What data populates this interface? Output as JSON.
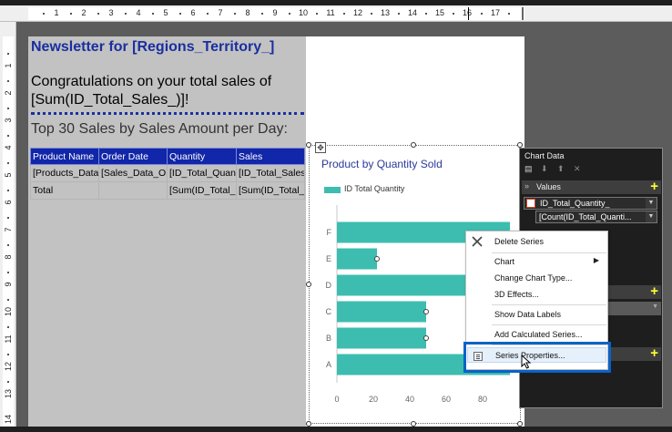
{
  "ruler": {
    "h_numbers": [
      "1",
      "2",
      "3",
      "4",
      "5",
      "6",
      "7",
      "8",
      "9",
      "10",
      "11",
      "12",
      "13",
      "14",
      "15",
      "16",
      "17"
    ],
    "v_numbers": [
      "1",
      "2",
      "3",
      "4",
      "5",
      "6",
      "7",
      "8",
      "9",
      "10",
      "11",
      "12",
      "13",
      "14"
    ]
  },
  "report": {
    "title": "Newsletter for [Regions_Territory_]",
    "congrats": "Congratulations on your total sales of [Sum(ID_Total_Sales_)]!",
    "top30": "Top 30 Sales by Sales Amount per Day:",
    "table": {
      "headers": [
        "Product Name",
        "Order Date",
        "Quantity",
        "Sales"
      ],
      "rows": [
        [
          "[Products_Data_",
          "[Sales_Data_Or",
          "[ID_Total_Quant",
          "[ID_Total_Sales"
        ],
        [
          "Total",
          "",
          "[Sum(ID_Total_(",
          "[Sum(ID_Total_"
        ]
      ]
    }
  },
  "chart": {
    "title": "Product by Quantity Sold",
    "legend": "ID Total Quantity",
    "categories": [
      "F",
      "E",
      "D",
      "C",
      "B",
      "A"
    ],
    "x_ticks": [
      "0",
      "20",
      "40",
      "60",
      "80"
    ]
  },
  "chart_data": {
    "type": "bar",
    "orientation": "horizontal",
    "title": "Product by Quantity Sold",
    "categories": [
      "A",
      "B",
      "C",
      "D",
      "E",
      "F"
    ],
    "series": [
      {
        "name": "ID Total Quantity",
        "values": [
          95,
          49,
          49,
          95,
          22,
          95
        ]
      }
    ],
    "xlim": [
      0,
      95
    ],
    "x_ticks": [
      0,
      20,
      40,
      60,
      80
    ],
    "legend_position": "top-left",
    "grid": false,
    "color": "#3dbdaf"
  },
  "chart_data_panel": {
    "title": "Chart Data",
    "values_label": "Values",
    "field_label": "ID_Total_Quantity_",
    "expr_label": "[Count(ID_Total_Quanti..."
  },
  "context_menu": {
    "items": [
      "Delete Series",
      "Chart",
      "Change Chart Type...",
      "3D Effects...",
      "Show Data Labels",
      "Add Calculated Series...",
      "Series Properties..."
    ]
  },
  "colors": {
    "accent": "#0a62c8",
    "title_blue": "#1a2fa0",
    "header_blue": "#1126a8",
    "bar_teal": "#3dbdaf",
    "plus_yellow": "#ffff33"
  }
}
